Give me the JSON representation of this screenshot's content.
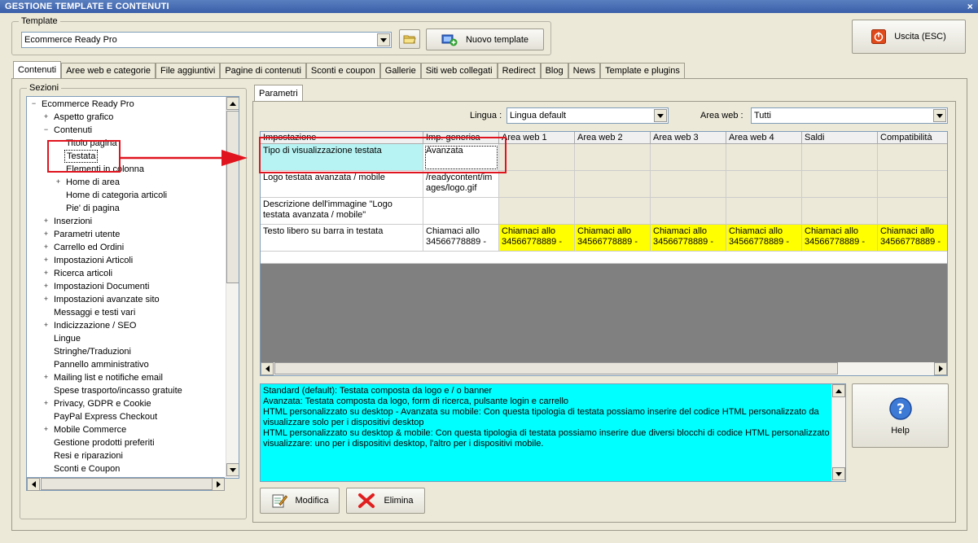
{
  "window": {
    "title": "GESTIONE TEMPLATE E CONTENUTI",
    "close": "×"
  },
  "template": {
    "group_label": "Template",
    "selected": "Ecommerce Ready Pro",
    "new_button": "Nuovo template"
  },
  "exit_button": "Uscita (ESC)",
  "tabs": [
    "Contenuti",
    "Aree web e categorie",
    "File aggiuntivi",
    "Pagine di contenuti",
    "Sconti e coupon",
    "Gallerie",
    "Siti web collegati",
    "Redirect",
    "Blog",
    "News",
    "Template e plugins"
  ],
  "sections": {
    "label": "Sezioni",
    "items": [
      {
        "label": "Ecommerce Ready Pro",
        "level": 0,
        "exp": "−"
      },
      {
        "label": "Aspetto grafico",
        "level": 1,
        "exp": "+"
      },
      {
        "label": "Contenuti",
        "level": 1,
        "exp": "−"
      },
      {
        "label": "Titolo pagina",
        "level": 2,
        "exp": ""
      },
      {
        "label": "Testata",
        "level": 2,
        "exp": "",
        "selected": true
      },
      {
        "label": "Elementi in colonna",
        "level": 2,
        "exp": ""
      },
      {
        "label": "Home di area",
        "level": 2,
        "exp": "+"
      },
      {
        "label": "Home di categoria articoli",
        "level": 2,
        "exp": ""
      },
      {
        "label": "Pie' di pagina",
        "level": 2,
        "exp": ""
      },
      {
        "label": "Inserzioni",
        "level": 1,
        "exp": "+"
      },
      {
        "label": "Parametri utente",
        "level": 1,
        "exp": "+"
      },
      {
        "label": "Carrello ed Ordini",
        "level": 1,
        "exp": "+"
      },
      {
        "label": "Impostazioni Articoli",
        "level": 1,
        "exp": "+"
      },
      {
        "label": "Ricerca articoli",
        "level": 1,
        "exp": "+"
      },
      {
        "label": "Impostazioni Documenti",
        "level": 1,
        "exp": "+"
      },
      {
        "label": "Impostazioni avanzate sito",
        "level": 1,
        "exp": "+"
      },
      {
        "label": "Messaggi e testi vari",
        "level": 1,
        "exp": ""
      },
      {
        "label": "Indicizzazione / SEO",
        "level": 1,
        "exp": "+"
      },
      {
        "label": "Lingue",
        "level": 1,
        "exp": ""
      },
      {
        "label": "Stringhe/Traduzioni",
        "level": 1,
        "exp": ""
      },
      {
        "label": "Pannello amministrativo",
        "level": 1,
        "exp": ""
      },
      {
        "label": "Mailing list e notifiche email",
        "level": 1,
        "exp": "+"
      },
      {
        "label": "Spese trasporto/incasso gratuite",
        "level": 1,
        "exp": ""
      },
      {
        "label": "Privacy, GDPR e Cookie",
        "level": 1,
        "exp": "+"
      },
      {
        "label": "PayPal Express Checkout",
        "level": 1,
        "exp": ""
      },
      {
        "label": "Mobile Commerce",
        "level": 1,
        "exp": "+"
      },
      {
        "label": "Gestione prodotti preferiti",
        "level": 1,
        "exp": ""
      },
      {
        "label": "Resi e riparazioni",
        "level": 1,
        "exp": ""
      },
      {
        "label": "Sconti e Coupon",
        "level": 1,
        "exp": ""
      }
    ]
  },
  "params_tab": "Parametri",
  "lingua": {
    "label": "Lingua :",
    "value": "Lingua default"
  },
  "area_web": {
    "label": "Area web :",
    "value": "Tutti"
  },
  "grid": {
    "columns": [
      "Impostazione",
      "Imp. generica",
      "Area web 1",
      "Area web 2",
      "Area web 3",
      "Area web 4",
      "Saldi",
      "Compatibilità"
    ],
    "rows": [
      {
        "name": "Tipo di visualizzazione testata",
        "generic": "Avanzata",
        "areas": [
          "",
          "",
          "",
          "",
          "",
          ""
        ]
      },
      {
        "name": "Logo testata avanzata / mobile",
        "generic": "/readycontent/images/logo.gif",
        "areas": [
          "",
          "",
          "",
          "",
          "",
          ""
        ]
      },
      {
        "name": "Descrizione dell'immagine \"Logo testata avanzata / mobile\"",
        "generic": "",
        "areas": [
          "",
          "",
          "",
          "",
          "",
          ""
        ]
      },
      {
        "name": "Testo libero su barra in testata",
        "generic": "Chiamaci allo 34566778889 -",
        "areas": [
          "Chiamaci allo 34566778889 -",
          "Chiamaci allo 34566778889 -",
          "Chiamaci allo 34566778889 -",
          "Chiamaci allo 34566778889 -",
          "Chiamaci allo 34566778889 -",
          "Chiamaci allo 34566778889 -"
        ]
      }
    ]
  },
  "description": [
    "Standard (default): Testata composta da logo e / o banner",
    "Avanzata: Testata composta da logo, form di ricerca, pulsante login e carrello",
    "HTML personalizzato su desktop - Avanzata su mobile: Con questa tipologia di testata possiamo inserire del codice HTML personalizzato da visualizzare solo per i dispositivi desktop",
    "HTML personalizzato su desktop & mobile: Con questa tipologia di testata possiamo inserire due diversi blocchi di codice HTML personalizzato da visualizzare: uno per i dispositivi desktop, l'altro per i dispositivi mobile."
  ],
  "help_button": "Help",
  "edit_button": "Modifica",
  "delete_button": "Elimina",
  "colors": {
    "highlight_yellow": "#ffff00",
    "description_bg": "#00ffff",
    "selected_cell": "#b8f3f3",
    "annotation_red": "#e0141e"
  }
}
